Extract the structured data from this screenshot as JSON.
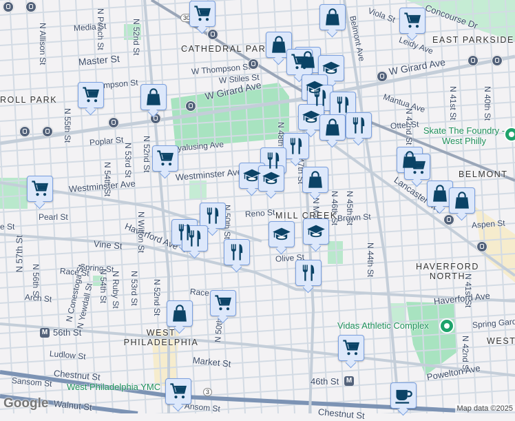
{
  "map": {
    "attribution": "Map data ©2025",
    "logo": "Google",
    "route_shields": [
      "30",
      "3"
    ],
    "area_labels": [
      "CATHEDRAL PARK",
      "EAST PARKSIDE",
      "ROLL PARK",
      "BELMONT",
      "MILL CREEK",
      "HAVERFORD NORTH",
      "WEST PHILADELPHIA",
      "WEST"
    ],
    "poi_labels": [
      "Skate The Foundry - West Philly",
      "Vidas Athletic Complex",
      "West Philadelphia YMC"
    ],
    "metro_stations": [
      "56th St",
      "46th St"
    ],
    "street_labels": [
      "N Allison St",
      "N Peach St",
      "Media St",
      "N 52nd St",
      "Master St",
      "W Thompson St",
      "W Stiles St",
      "mpson St",
      "W Girard Ave",
      "N 55th St",
      "Poplar St",
      "N 54th St",
      "N 53rd St",
      "N 52nd St",
      "yalusing Ave",
      "Westminster Ave",
      "Westminster Ave",
      "Pearl St",
      "Haverford Ave",
      "Vine St",
      "N 57th St",
      "N 56th St",
      "Spring St",
      "Race St",
      "N 54th St",
      "N Ruby St",
      "N 53rd St",
      "N 52nd St",
      "Race St",
      "Arch St",
      "N Conestoga St",
      "N Yewdall St",
      "N 50th St",
      "Market St",
      "Ludlow St",
      "Chestnut St",
      "Sansom St",
      "Walnut St",
      "Viola St",
      "Concourse Dr",
      "Leidy Ave",
      "Belmont Ave",
      "W Girard Ave",
      "Mantua Ave",
      "N 42nd St",
      "N 41st St",
      "N 40th St",
      "Otter St",
      "N 48th St",
      "N 47th St",
      "N Markoe St",
      "N 46th St",
      "N 45th St",
      "Lancaster Ave",
      "Brown St",
      "Aspen St",
      "N 44th St",
      "Olive St",
      "Haverford Ave",
      "Spring Garden",
      "N 42nd St",
      "N 41st St",
      "Powelton Ave",
      "Reno St",
      "N 50th St",
      "N Wilton St",
      "e St",
      "Chestnut St",
      "Ansom St"
    ],
    "marker_types": [
      "grocery-cart",
      "shopping-bag",
      "restaurant-fork-knife",
      "school-graduation-cap",
      "cafe-coffee-cup"
    ]
  }
}
